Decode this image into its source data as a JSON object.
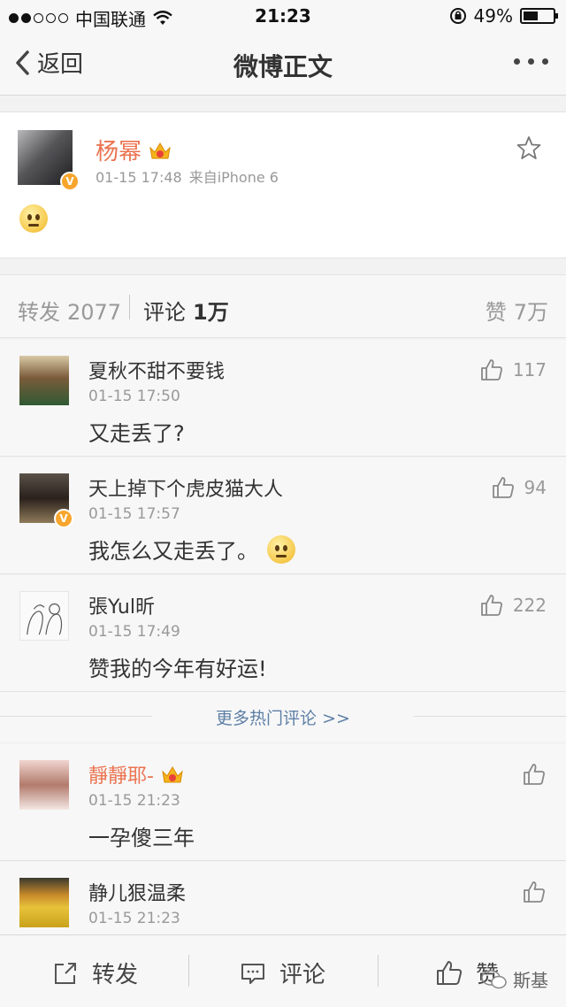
{
  "status_bar": {
    "carrier": "中国联通",
    "time": "21:23",
    "battery": "49%",
    "battery_level": 0.49
  },
  "nav": {
    "back_label": "返回",
    "title": "微博正文"
  },
  "post": {
    "author": "杨幂",
    "time": "01-15 17:48",
    "source": "来自iPhone 6"
  },
  "tabs": {
    "repost_label": "转发",
    "repost_count": "2077",
    "comment_label": "评论",
    "comment_count": "1万",
    "like_label": "赞",
    "like_count": "7万"
  },
  "comments": [
    {
      "name": "夏秋不甜不要钱",
      "time": "01-15 17:50",
      "text": "又走丢了?",
      "likes": "117"
    },
    {
      "name": "天上掉下个虎皮猫大人",
      "time": "01-15 17:57",
      "text": "我怎么又走丢了。",
      "likes": "94"
    },
    {
      "name": "張Yul昕",
      "time": "01-15 17:49",
      "text": "赞我的今年有好运!",
      "likes": "222"
    },
    {
      "name": "靜靜耶-",
      "time": "01-15 21:23",
      "text": "一孕傻三年",
      "likes": ""
    },
    {
      "name": "静儿狠温柔",
      "time": "01-15 21:23",
      "text": "",
      "likes": ""
    }
  ],
  "more_hot_comments": "更多热门评论 >>",
  "toolbar": {
    "repost": "转发",
    "comment": "评论",
    "like": "赞"
  },
  "watermark": "斯基",
  "colors": {
    "orange_name": "#eb7350",
    "link_blue": "#5d7fa6",
    "verified_badge": "#f7a52c"
  }
}
